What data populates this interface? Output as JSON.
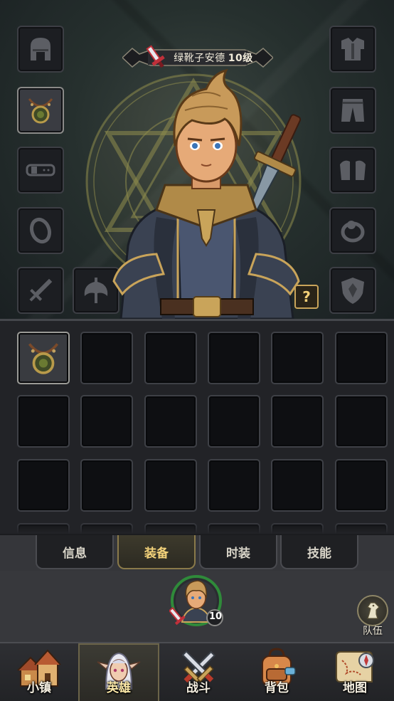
{
  "hero": {
    "name": "绿靴子安德",
    "level_text": "10级",
    "portrait_level": "10"
  },
  "equipment_slots": {
    "left": [
      "helmet-icon",
      "amulet-icon",
      "belt-icon",
      "ring-icon",
      "sword-icon"
    ],
    "right": [
      "chest-armor-icon",
      "pants-icon",
      "gauntlets-icon",
      "ring-icon",
      "shield-icon"
    ],
    "offhand": "axe-icon"
  },
  "help_button": "?",
  "inventory": {
    "rows": 4,
    "columns": 6,
    "filled": [
      {
        "index": 0,
        "item": "amulet-icon"
      }
    ]
  },
  "tabs": [
    {
      "label": "信息",
      "active": false
    },
    {
      "label": "装备",
      "active": true
    },
    {
      "label": "时装",
      "active": false
    },
    {
      "label": "技能",
      "active": false
    }
  ],
  "team": {
    "label": "队伍"
  },
  "nav": [
    {
      "label": "小镇",
      "icon": "town-icon",
      "active": false
    },
    {
      "label": "英雄",
      "icon": "hero-icon",
      "active": true
    },
    {
      "label": "战斗",
      "icon": "battle-icon",
      "active": false
    },
    {
      "label": "背包",
      "icon": "backpack-icon",
      "active": false
    },
    {
      "label": "地图",
      "icon": "map-icon",
      "active": false
    }
  ],
  "colors": {
    "gold_accent": "#c9a45a",
    "active_tab_text": "#f3d27a",
    "background": "#151619"
  }
}
